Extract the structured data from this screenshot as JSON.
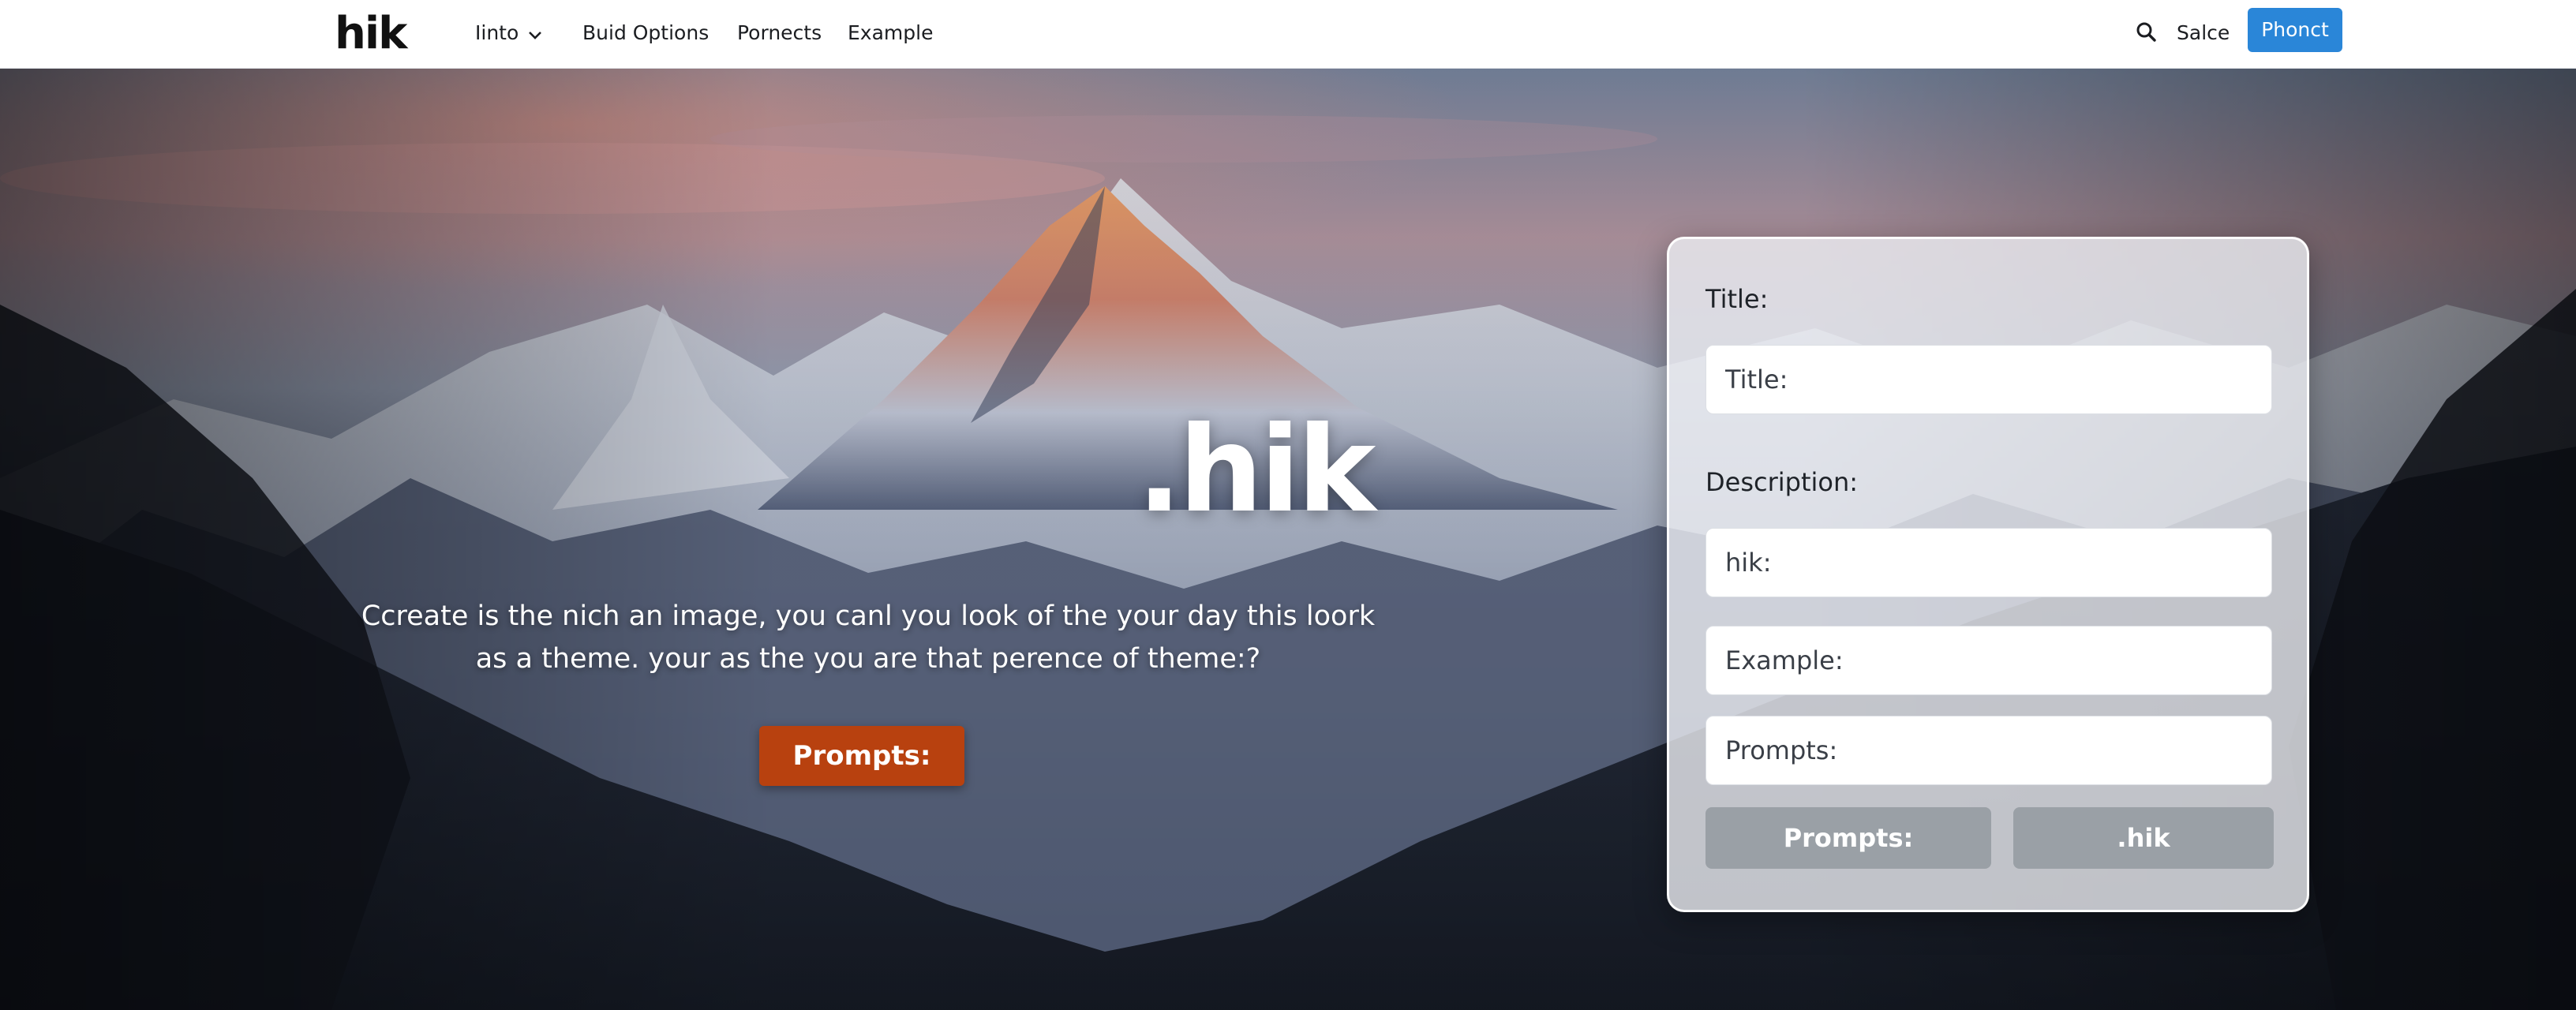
{
  "brand": {
    "logo": "hik"
  },
  "nav": {
    "links": [
      {
        "label": "Iinto",
        "has_dropdown": true
      },
      {
        "label": "Buid Options"
      },
      {
        "label": "Pornects"
      },
      {
        "label": "Example"
      }
    ],
    "right_link": "Salce",
    "cta": "Phonct",
    "icons": {
      "search": "search-icon",
      "dropdown": "chevron-down-icon"
    },
    "colors": {
      "cta": "#2a86d8"
    }
  },
  "hero": {
    "title": ".hik",
    "description": "Ccreate is the nich an image, you canl you look of the your day this loork as a theme. your as the you are that perence of theme:?",
    "button": "Prompts:",
    "colors": {
      "button": "#b8410f"
    }
  },
  "form": {
    "title_label": "Title:",
    "title_placeholder": "Title:",
    "description_label": "Description:",
    "fields": [
      {
        "placeholder": "hik:"
      },
      {
        "placeholder": "Example:"
      },
      {
        "placeholder": "Prompts:"
      }
    ],
    "buttons": {
      "primary": "Prompts:",
      "secondary": ".hik"
    },
    "colors": {
      "buttons": "#9aa0a6"
    }
  }
}
